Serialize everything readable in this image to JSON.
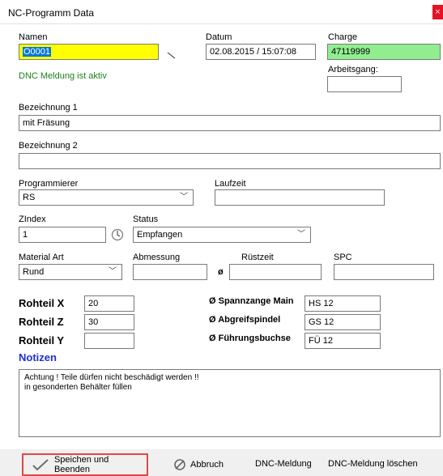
{
  "window": {
    "title": "NC-Programm Data",
    "close_label": "×"
  },
  "namen": {
    "label": "Namen",
    "value": "O0001",
    "bg": "#ffff00"
  },
  "datum": {
    "label": "Datum",
    "value": "02.08.2015 / 15:07:08"
  },
  "charge": {
    "label": "Charge",
    "value": "47119999",
    "bg": "#90ee90"
  },
  "dnc_status": "DNC Meldung ist aktiv",
  "arbeitsgang": {
    "label": "Arbeitsgang:",
    "value": ""
  },
  "bezeichnung1": {
    "label": "Bezeichnung 1",
    "value": "mit Fräsung"
  },
  "bezeichnung2": {
    "label": "Bezeichnung 2",
    "value": ""
  },
  "programmierer": {
    "label": "Programmierer",
    "value": "RS"
  },
  "laufzeit": {
    "label": "Laufzeit",
    "value": ""
  },
  "zindex": {
    "label": "ZIndex",
    "value": "1"
  },
  "status": {
    "label": "Status",
    "value": "Empfangen"
  },
  "material_art": {
    "label": "Material Art",
    "value": "Rund"
  },
  "abmessung": {
    "label": "Abmessung",
    "value": "",
    "symbol": "ø"
  },
  "ruestzeit": {
    "label": "Rüstzeit",
    "value": ""
  },
  "spc": {
    "label": "SPC",
    "value": ""
  },
  "rohteil_x": {
    "label": "Rohteil X",
    "value": "20"
  },
  "rohteil_z": {
    "label": "Rohteil Z",
    "value": "30"
  },
  "rohteil_y": {
    "label": "Rohteil Y",
    "value": ""
  },
  "spannzange": {
    "label": "Ø Spannzange Main",
    "value": "HS 12"
  },
  "abgreifspindel": {
    "label": "Ø Abgreifspindel",
    "value": "GS 12"
  },
  "fuehrungsbuchse": {
    "label": "Ø Führungsbuchse",
    "value": "FÜ 12"
  },
  "notizen": {
    "label": "Notizen",
    "value": "Achtung ! Teile dürfen nicht beschädigt werden !!\nin gesonderten Behälter füllen"
  },
  "footer": {
    "save": "Speichen und Beenden",
    "cancel": "Abbruch",
    "dnc": "DNC-Meldung",
    "dnc_delete": "DNC-Meldung löschen"
  },
  "icons": {
    "save": "checkmark-icon",
    "cancel": "cancel-circle-icon",
    "zindex": "cycle-icon",
    "dropdown": "chevron-down-icon"
  }
}
